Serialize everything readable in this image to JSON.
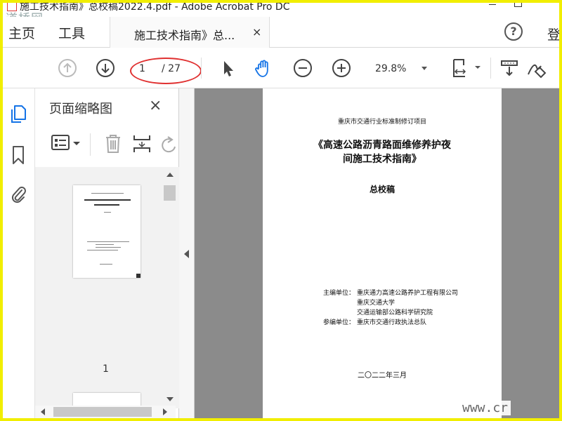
{
  "window": {
    "title": "施工技术指南》总校稿2022.4.pdf - Adobe Acrobat Pro DC",
    "watermark_top": "道桥网",
    "watermark_bottom": "www.cr"
  },
  "menubar": {
    "home": "主页",
    "tools": "工具",
    "tab_label": "施工技术指南》总...",
    "tab_close": "×",
    "help": "?",
    "login": "登"
  },
  "toolbar": {
    "current_page": "1",
    "total_pages": "/ 27",
    "zoom": "29.8%",
    "icons": [
      "prev-page-icon",
      "next-page-icon",
      "select-cursor-icon",
      "hand-tool-icon",
      "zoom-out-icon",
      "zoom-in-icon",
      "fit-page-icon",
      "scroll-mode-icon",
      "sign-icon"
    ]
  },
  "panel": {
    "title": "页面缩略图",
    "close": "×",
    "thumbnail_page_label": "1"
  },
  "document": {
    "org_line": "重庆市交通行业标准制修订项目",
    "title_line1": "《高速公路沥青路面维修养护夜",
    "title_line2": "间施工技术指南》",
    "subtitle": "总校稿",
    "editor_label": "主编单位：",
    "editor_1": "重庆通力高速公路养护工程有限公司",
    "editor_2": "重庆交通大学",
    "editor_3": "交通运输部公路科学研究院",
    "participant_label": "参编单位：",
    "participant_1": "重庆市交通行政执法总队",
    "date": "二〇二二年三月"
  },
  "colors": {
    "accent": "#1473e6",
    "annotation_ellipse": "#e03030",
    "screenshot_border": "#f1ee00",
    "doc_background": "#8b8b8b"
  }
}
